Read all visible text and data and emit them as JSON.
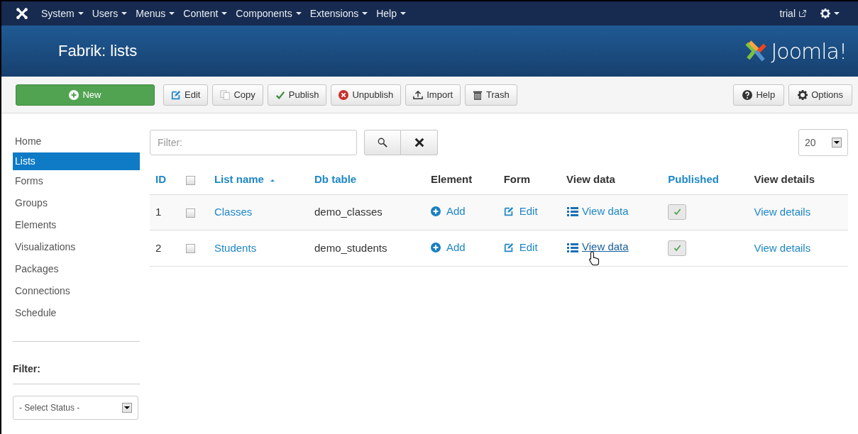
{
  "top_menu": [
    {
      "label": "System"
    },
    {
      "label": "Users"
    },
    {
      "label": "Menus"
    },
    {
      "label": "Content"
    },
    {
      "label": "Components"
    },
    {
      "label": "Extensions"
    },
    {
      "label": "Help"
    }
  ],
  "user_menu": {
    "label": "trial"
  },
  "header": {
    "title": "Fabrik: lists",
    "brand": "Joomla!"
  },
  "toolbar": [
    {
      "label": "New",
      "kind": "success"
    },
    {
      "label": "Edit",
      "kind": "default"
    },
    {
      "label": "Copy",
      "kind": "default"
    },
    {
      "label": "Publish",
      "kind": "default"
    },
    {
      "label": "Unpublish",
      "kind": "default"
    },
    {
      "label": "Import",
      "kind": "default"
    },
    {
      "label": "Trash",
      "kind": "default"
    }
  ],
  "toolbar_right": [
    {
      "label": "Help"
    },
    {
      "label": "Options"
    }
  ],
  "sidebar": {
    "items": [
      {
        "label": "Home",
        "selected": false
      },
      {
        "label": "Lists",
        "selected": true
      },
      {
        "label": "Forms",
        "selected": false
      },
      {
        "label": "Groups",
        "selected": false
      },
      {
        "label": "Elements",
        "selected": false
      },
      {
        "label": "Visualizations",
        "selected": false
      },
      {
        "label": "Packages",
        "selected": false
      },
      {
        "label": "Connections",
        "selected": false
      },
      {
        "label": "Schedule",
        "selected": false
      }
    ],
    "filter_heading": "Filter:",
    "status_select": {
      "value": "- Select Status -"
    }
  },
  "search": {
    "placeholder": "Filter:"
  },
  "page_size": {
    "value": "20"
  },
  "table": {
    "select_all": {
      "checked": false
    },
    "columns": [
      {
        "label": "ID",
        "sortable": true,
        "sorted": false
      },
      {
        "kind": "checkbox"
      },
      {
        "label": "List name",
        "sortable": true,
        "sorted": true
      },
      {
        "label": "Db table",
        "sortable": true,
        "sorted": false
      },
      {
        "label": "Element",
        "sortable": false
      },
      {
        "label": "Form",
        "sortable": false
      },
      {
        "label": "View data",
        "sortable": false
      },
      {
        "label": "Published",
        "sortable": true,
        "sorted": false
      },
      {
        "label": "View details",
        "sortable": false
      }
    ],
    "rows": [
      {
        "id": "1",
        "checked": false,
        "name": "Classes",
        "db_table": "demo_classes",
        "element": "Add",
        "form": "Edit",
        "view_data": "View data",
        "view_data_hovered": false,
        "published": true,
        "view_details": "View details"
      },
      {
        "id": "2",
        "checked": false,
        "name": "Students",
        "db_table": "demo_students",
        "element": "Add",
        "form": "Edit",
        "view_data": "View data",
        "view_data_hovered": true,
        "published": true,
        "view_details": "View details"
      }
    ]
  }
}
